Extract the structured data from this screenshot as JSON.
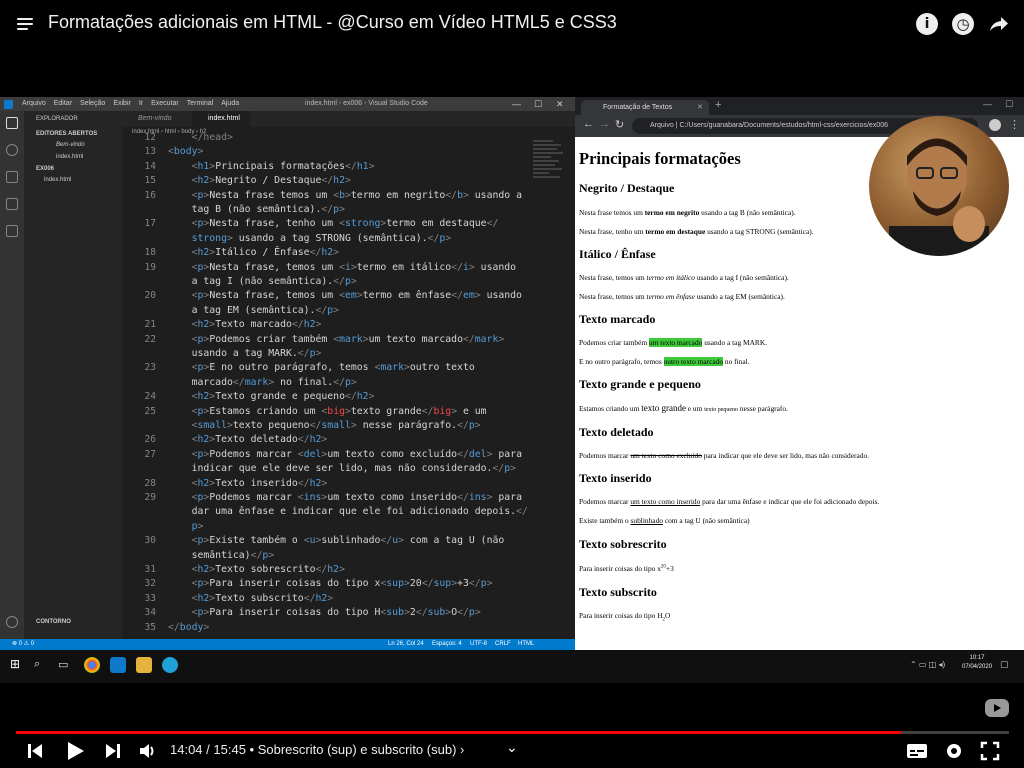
{
  "video": {
    "title": "Formatações adicionais em HTML - @Curso em Vídeo HTML5 e CSS3",
    "current": "14:04",
    "duration": "15:45",
    "time_sep": " / ",
    "chapter": " • Sobrescrito (sup) e subscrito (sub)",
    "chevron": "›",
    "progress": 0.891,
    "accent": "#ff0000"
  },
  "top_icons": {
    "info": "i",
    "clock": "◷"
  },
  "vscode": {
    "menu": [
      "Arquivo",
      "Editar",
      "Seleção",
      "Exibir",
      "Ir",
      "Executar",
      "Terminal",
      "Ajuda"
    ],
    "window_title": "index.html - ex006 - Visual Studio Code",
    "explorer": {
      "header": "EXPLORADOR",
      "open_editors": "EDITORES ABERTOS",
      "open1": "Bem-vindo",
      "open2": "index.html",
      "folder": "EX006",
      "file": "index.html",
      "outline": "CONTORNO"
    },
    "tabs": [
      "Bem-vindo",
      "index.html"
    ],
    "crumbs": "index.html › html › body › h2",
    "lines": [
      {
        "n": "12",
        "h": "<span class='p'>    &lt;/head&gt;</span>"
      },
      {
        "n": "13",
        "h": "<span class='p'>&lt;</span><span class='t'>body</span><span class='p'>&gt;</span>"
      },
      {
        "n": "14",
        "h": "    <span class='p'>&lt;</span><span class='t'>h1</span><span class='p'>&gt;</span>Principais formatações<span class='p'>&lt;/</span><span class='t'>h1</span><span class='p'>&gt;</span>"
      },
      {
        "n": "15",
        "h": "    <span class='p'>&lt;</span><span class='t'>h2</span><span class='p'>&gt;</span>Negrito / Destaque<span class='p'>&lt;/</span><span class='t'>h2</span><span class='p'>&gt;</span>"
      },
      {
        "n": "16",
        "h": "    <span class='p'>&lt;</span><span class='t'>p</span><span class='p'>&gt;</span>Nesta frase temos um <span class='p'>&lt;</span><span class='t'>b</span><span class='p'>&gt;</span>termo em negrito<span class='p'>&lt;/</span><span class='t'>b</span><span class='p'>&gt;</span> usando a"
      },
      {
        "n": "",
        "h": "    tag B (não semântica).<span class='p'>&lt;/</span><span class='t'>p</span><span class='p'>&gt;</span>"
      },
      {
        "n": "17",
        "h": "    <span class='p'>&lt;</span><span class='t'>p</span><span class='p'>&gt;</span>Nesta frase, tenho um <span class='p'>&lt;</span><span class='t'>strong</span><span class='p'>&gt;</span>termo em destaque<span class='p'>&lt;/</span>"
      },
      {
        "n": "",
        "h": "    <span class='t'>strong</span><span class='p'>&gt;</span> usando a tag STRONG (semântica).<span class='p'>&lt;/</span><span class='t'>p</span><span class='p'>&gt;</span>"
      },
      {
        "n": "18",
        "h": "    <span class='p'>&lt;</span><span class='t'>h2</span><span class='p'>&gt;</span>Itálico / Ênfase<span class='p'>&lt;/</span><span class='t'>h2</span><span class='p'>&gt;</span>"
      },
      {
        "n": "19",
        "h": "    <span class='p'>&lt;</span><span class='t'>p</span><span class='p'>&gt;</span>Nesta frase, temos um <span class='p'>&lt;</span><span class='t'>i</span><span class='p'>&gt;</span>termo em itálico<span class='p'>&lt;/</span><span class='t'>i</span><span class='p'>&gt;</span> usando"
      },
      {
        "n": "",
        "h": "    a tag I (não semântica).<span class='p'>&lt;/</span><span class='t'>p</span><span class='p'>&gt;</span>"
      },
      {
        "n": "20",
        "h": "    <span class='p'>&lt;</span><span class='t'>p</span><span class='p'>&gt;</span>Nesta frase, temos um <span class='p'>&lt;</span><span class='t'>em</span><span class='p'>&gt;</span>termo em ênfase<span class='p'>&lt;/</span><span class='t'>em</span><span class='p'>&gt;</span> usando"
      },
      {
        "n": "",
        "h": "    a tag EM (semântica).<span class='p'>&lt;/</span><span class='t'>p</span><span class='p'>&gt;</span>"
      },
      {
        "n": "21",
        "h": "    <span class='p'>&lt;</span><span class='t'>h2</span><span class='p'>&gt;</span>Texto marcado<span class='p'>&lt;/</span><span class='t'>h2</span><span class='p'>&gt;</span>"
      },
      {
        "n": "22",
        "h": "    <span class='p'>&lt;</span><span class='t'>p</span><span class='p'>&gt;</span>Podemos criar também <span class='p'>&lt;</span><span class='t'>mark</span><span class='p'>&gt;</span>um texto marcado<span class='p'>&lt;/</span><span class='t'>mark</span><span class='p'>&gt;</span>"
      },
      {
        "n": "",
        "h": "    usando a tag MARK.<span class='p'>&lt;/</span><span class='t'>p</span><span class='p'>&gt;</span>"
      },
      {
        "n": "23",
        "h": "    <span class='p'>&lt;</span><span class='t'>p</span><span class='p'>&gt;</span>E no outro parágrafo, temos <span class='p'>&lt;</span><span class='t'>mark</span><span class='p'>&gt;</span>outro texto"
      },
      {
        "n": "",
        "h": "    marcado<span class='p'>&lt;/</span><span class='t'>mark</span><span class='p'>&gt;</span> no final.<span class='p'>&lt;/</span><span class='t'>p</span><span class='p'>&gt;</span>"
      },
      {
        "n": "24",
        "h": "    <span class='p'>&lt;</span><span class='t'>h2</span><span class='p'>&gt;</span>Texto grande e pequeno<span class='p'>&lt;/</span><span class='t'>h2</span><span class='p'>&gt;</span>"
      },
      {
        "n": "25",
        "h": "    <span class='p'>&lt;</span><span class='t'>p</span><span class='p'>&gt;</span>Estamos criando um <span class='p'>&lt;</span><span class='r'>big</span><span class='p'>&gt;</span>texto grande<span class='p'>&lt;/</span><span class='r'>big</span><span class='p'>&gt;</span> e um"
      },
      {
        "n": "",
        "h": "    <span class='p'>&lt;</span><span class='t'>small</span><span class='p'>&gt;</span>texto pequeno<span class='p'>&lt;/</span><span class='t'>small</span><span class='p'>&gt;</span> nesse parágrafo.<span class='p'>&lt;/</span><span class='t'>p</span><span class='p'>&gt;</span>"
      },
      {
        "n": "26",
        "h": "    <span class='p'>&lt;</span><span class='t'>h2</span><span class='p'>&gt;</span>Texto deletado<span class='p'>&lt;/</span><span class='t'>h2</span><span class='p'>&gt;</span>"
      },
      {
        "n": "27",
        "h": "    <span class='p'>&lt;</span><span class='t'>p</span><span class='p'>&gt;</span>Podemos marcar <span class='p'>&lt;</span><span class='t'>del</span><span class='p'>&gt;</span>um texto como excluído<span class='p'>&lt;/</span><span class='t'>del</span><span class='p'>&gt;</span> para"
      },
      {
        "n": "",
        "h": "    indicar que ele deve ser lido, mas não considerado.<span class='p'>&lt;/</span><span class='t'>p</span><span class='p'>&gt;</span>"
      },
      {
        "n": "28",
        "h": "    <span class='p'>&lt;</span><span class='t'>h2</span><span class='p'>&gt;</span>Texto inserido<span class='p'>&lt;/</span><span class='t'>h2</span><span class='p'>&gt;</span>"
      },
      {
        "n": "29",
        "h": "    <span class='p'>&lt;</span><span class='t'>p</span><span class='p'>&gt;</span>Podemos marcar <span class='p'>&lt;</span><span class='t'>ins</span><span class='p'>&gt;</span>um texto como inserido<span class='p'>&lt;/</span><span class='t'>ins</span><span class='p'>&gt;</span> para"
      },
      {
        "n": "",
        "h": "    dar uma ênfase e indicar que ele foi adicionado depois.<span class='p'>&lt;/</span>"
      },
      {
        "n": "",
        "h": "    <span class='t'>p</span><span class='p'>&gt;</span>"
      },
      {
        "n": "30",
        "h": "    <span class='p'>&lt;</span><span class='t'>p</span><span class='p'>&gt;</span>Existe também o <span class='p'>&lt;</span><span class='t'>u</span><span class='p'>&gt;</span>sublinhado<span class='p'>&lt;/</span><span class='t'>u</span><span class='p'>&gt;</span> com a tag U (não"
      },
      {
        "n": "",
        "h": "    semântica)<span class='p'>&lt;/</span><span class='t'>p</span><span class='p'>&gt;</span>"
      },
      {
        "n": "31",
        "h": "    <span class='p'>&lt;</span><span class='t'>h2</span><span class='p'>&gt;</span>Texto sobrescrito<span class='p'>&lt;/</span><span class='t'>h2</span><span class='p'>&gt;</span>"
      },
      {
        "n": "32",
        "h": "    <span class='p'>&lt;</span><span class='t'>p</span><span class='p'>&gt;</span>Para inserir coisas do tipo x<span class='p'>&lt;</span><span class='t'>sup</span><span class='p'>&gt;</span>20<span class='p'>&lt;/</span><span class='t'>sup</span><span class='p'>&gt;</span>+3<span class='p'>&lt;/</span><span class='t'>p</span><span class='p'>&gt;</span>"
      },
      {
        "n": "33",
        "h": "    <span class='p'>&lt;</span><span class='t'>h2</span><span class='p'>&gt;</span>Texto subscrito<span class='p'>&lt;/</span><span class='t'>h2</span><span class='p'>&gt;</span>"
      },
      {
        "n": "34",
        "h": "    <span class='p'>&lt;</span><span class='t'>p</span><span class='p'>&gt;</span>Para inserir coisas do tipo H<span class='p'>&lt;</span><span class='t'>sub</span><span class='p'>&gt;</span>2<span class='p'>&lt;/</span><span class='t'>sub</span><span class='p'>&gt;</span>O<span class='p'>&lt;/</span><span class='t'>p</span><span class='p'>&gt;</span>"
      },
      {
        "n": "35",
        "h": "<span class='p'>&lt;/</span><span class='t'>body</span><span class='p'>&gt;</span>"
      }
    ],
    "status": {
      "problems": "⊗ 0 ⚠ 0",
      "position": "Ln 26, Col 24",
      "spaces": "Espaços: 4",
      "encoding": "UTF-8",
      "eol": "CRLF",
      "lang": "HTML"
    }
  },
  "chrome": {
    "tab_title": "Formatação de Textos",
    "address": "Arquivo  |  C:/Users/guanabara/Documents/estudos/html-css/exercicios/ex006",
    "content": {
      "h1": "Principais formatações",
      "s1": "Negrito / Destaque",
      "p1a": "Nesta frase temos um ",
      "p1b": "termo em negrito",
      "p1c": " usando a tag B (não semântica).",
      "p2a": "Nesta frase, tenho um ",
      "p2b": "termo em destaque",
      "p2c": " usando a tag STRONG (semântica).",
      "s2": "Itálico / Ênfase",
      "p3a": "Nesta frase, temos um ",
      "p3b": "termo em itálico",
      "p3c": " usando a tag I (não semântica).",
      "p4a": "Nesta frase, temos um ",
      "p4b": "termo em ênfase",
      "p4c": " usando a tag EM (semântica).",
      "s3": "Texto marcado",
      "p5a": "Podemos criar também ",
      "p5b": "um texto marcado",
      "p5c": " usando a tag MARK.",
      "p6a": "E no outro parágrafo, temos ",
      "p6b": "outro texto marcado",
      "p6c": " no final.",
      "s4": "Texto grande e pequeno",
      "p7a": "Estamos criando um ",
      "p7b": "texto grande",
      "p7c": " e um ",
      "p7d": "texto pequeno",
      "p7e": " nesse parágrafo.",
      "s5": "Texto deletado",
      "p8a": "Podemos marcar ",
      "p8b": "um texto como excluído",
      "p8c": " para indicar que ele deve ser lido, mas não considerado.",
      "s6": "Texto inserido",
      "p9a": "Podemos marcar ",
      "p9b": "um texto como inserido",
      "p9c": " para dar uma ênfase e indicar que ele foi adicionado depois.",
      "p10a": "Existe também o ",
      "p10b": "sublinhado",
      "p10c": " com a tag U (não semântica)",
      "s7": "Texto sobrescrito",
      "p11a": "Para inserir coisas do tipo x",
      "p11b": "20",
      "p11c": "+3",
      "s8": "Texto subscrito",
      "p12a": "Para inserir coisas do tipo H",
      "p12b": "2",
      "p12c": "O"
    }
  },
  "taskbar": {
    "time": "10:17",
    "date": "07/04/2020"
  }
}
